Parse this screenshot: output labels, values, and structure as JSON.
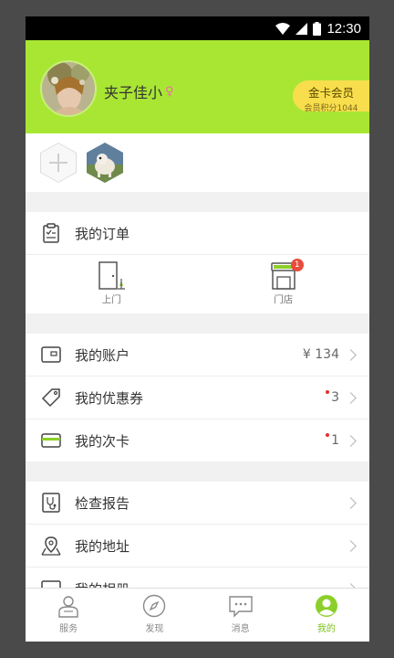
{
  "status": {
    "time": "12:30"
  },
  "profile": {
    "name": "夹子佳小",
    "gender_symbol": "♀"
  },
  "member": {
    "title": "金卡会员",
    "points": "会员积分1044"
  },
  "orders": {
    "label": "我的订单",
    "items": [
      {
        "label": "上门",
        "icon": "door-icon"
      },
      {
        "label": "门店",
        "icon": "store-icon",
        "badge": "1"
      }
    ]
  },
  "account": {
    "rows": [
      {
        "label": "我的账户",
        "value": "¥ 134",
        "icon": "wallet-icon"
      },
      {
        "label": "我的优惠券",
        "value": "3",
        "icon": "coupon-tag-icon"
      },
      {
        "label": "我的次卡",
        "value": "1",
        "icon": "card-icon"
      }
    ]
  },
  "more": {
    "rows": [
      {
        "label": "检查报告",
        "icon": "medical-report-icon"
      },
      {
        "label": "我的地址",
        "icon": "location-pin-icon"
      },
      {
        "label": "我的相册",
        "icon": "album-icon"
      }
    ]
  },
  "tabs": [
    {
      "label": "服务",
      "icon": "service-person-icon",
      "active": false
    },
    {
      "label": "发现",
      "icon": "compass-icon",
      "active": false
    },
    {
      "label": "消息",
      "icon": "message-bubble-icon",
      "active": false
    },
    {
      "label": "我的",
      "icon": "profile-icon",
      "active": true
    }
  ],
  "colors": {
    "header_green": "#a9e634",
    "badge_yellow": "#f8dd4c",
    "active_tab": "#7bc21a",
    "badge_red": "#e74c3c"
  }
}
